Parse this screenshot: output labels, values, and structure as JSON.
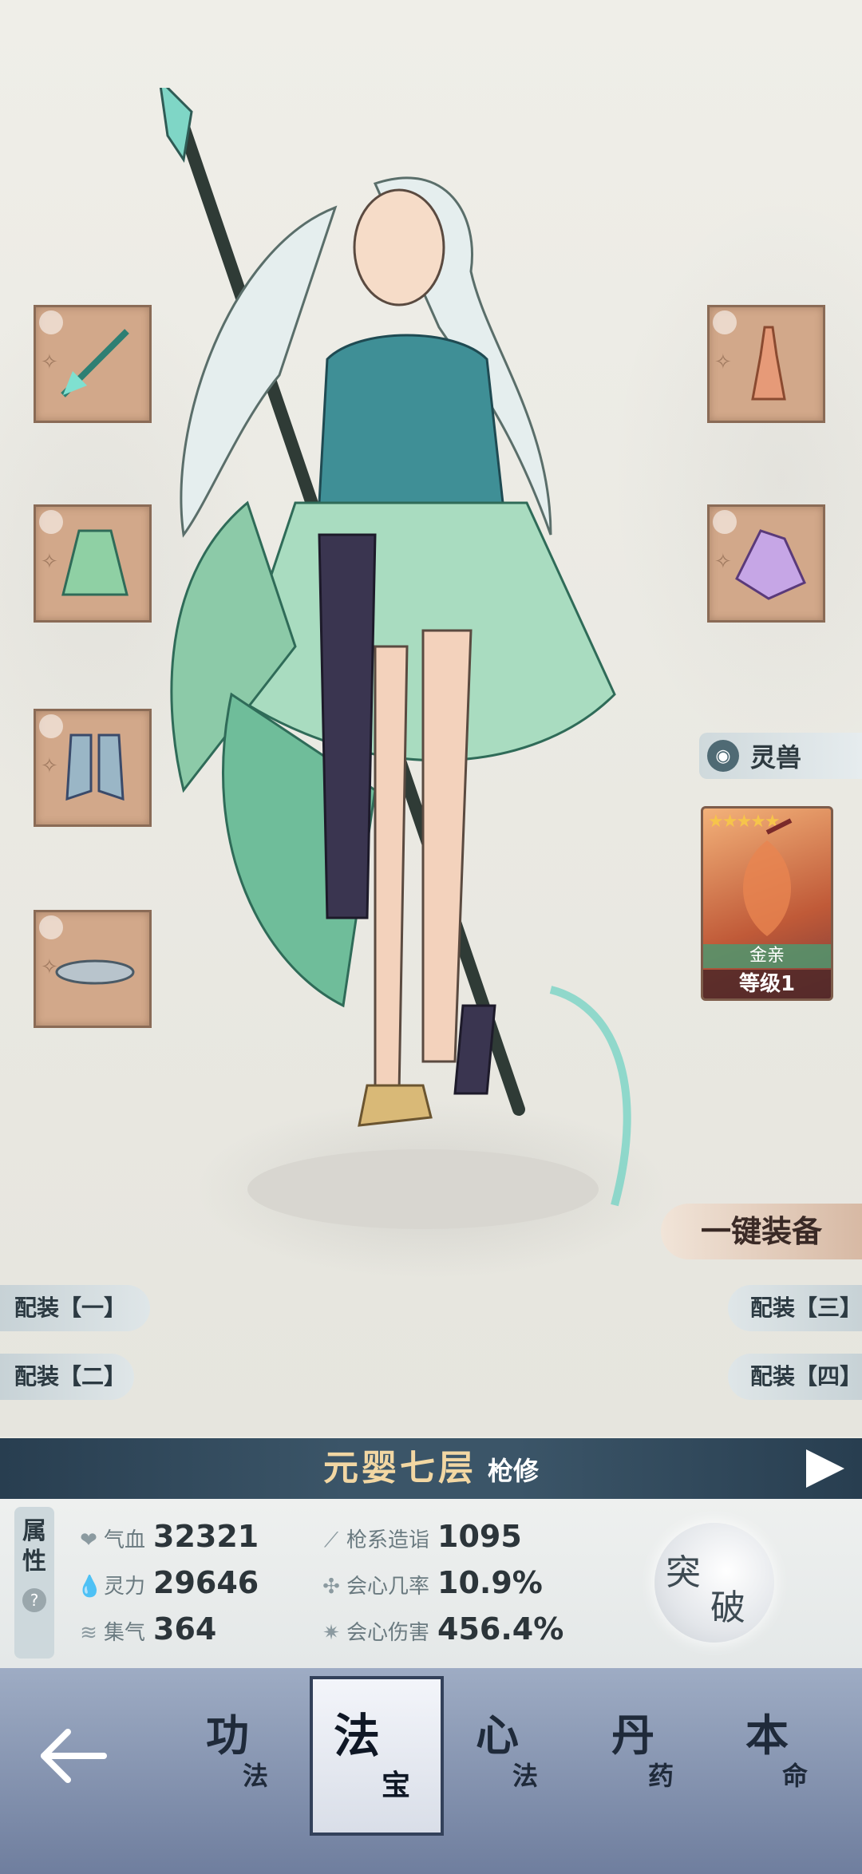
{
  "colors": {
    "accent": "#f2d7a3",
    "rankbar": "#3b5568",
    "slot": "#d2a88a",
    "navbar": "#6f7e9e"
  },
  "equipment": {
    "left": [
      {
        "icon": "spear-icon"
      },
      {
        "icon": "robe-icon"
      },
      {
        "icon": "boots-icon"
      },
      {
        "icon": "flying-boat-icon"
      }
    ],
    "right": [
      {
        "icon": "ornament-icon"
      },
      {
        "icon": "crystal-icon"
      }
    ]
  },
  "pet": {
    "label": "灵兽",
    "name": "金亲",
    "level": "等级1",
    "stars": 5
  },
  "one_key_equip": "一键装备",
  "loadouts": {
    "one": "配装【一】",
    "two": "配装【二】",
    "three": "配装【三】",
    "four": "配装【四】"
  },
  "rank": {
    "title": "元婴七层",
    "class": "枪修"
  },
  "attributes": {
    "tab_label_1": "属",
    "tab_label_2": "性",
    "help": "?",
    "hp": {
      "label": "气血",
      "value": "32321"
    },
    "mana": {
      "label": "灵力",
      "value": "29646"
    },
    "qi": {
      "label": "集气",
      "value": "364"
    },
    "spear": {
      "label": "枪系造诣",
      "value": "1095"
    },
    "crit_rate": {
      "label": "会心几率",
      "value": "10.9%"
    },
    "crit_damage": {
      "label": "会心伤害",
      "value": "456.4%"
    }
  },
  "breakthrough": {
    "char1": "突",
    "char2": "破"
  },
  "nav": {
    "items": [
      {
        "big": "功",
        "small": "法"
      },
      {
        "big": "法",
        "small": "宝"
      },
      {
        "big": "心",
        "small": "法"
      },
      {
        "big": "丹",
        "small": "药"
      },
      {
        "big": "本",
        "small": "命"
      }
    ]
  }
}
